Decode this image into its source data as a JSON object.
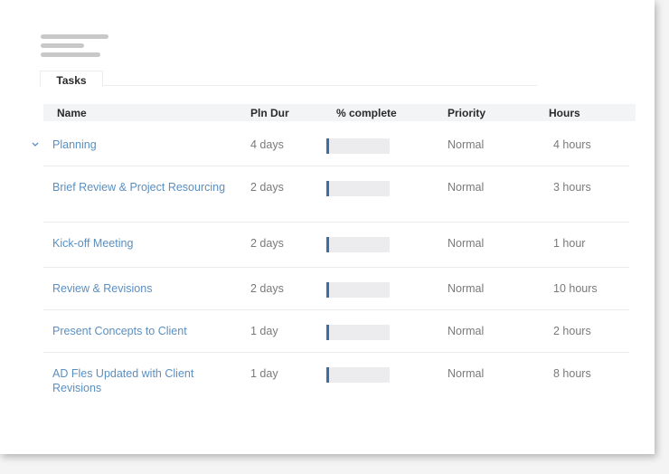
{
  "tabs": [
    {
      "label": "Tasks"
    }
  ],
  "columns": {
    "name": "Name",
    "pln_dur": "Pln Dur",
    "percent_complete": "% complete",
    "priority": "Priority",
    "hours": "Hours"
  },
  "rows": [
    {
      "name": "Planning",
      "pln_dur": "4 days",
      "percent_complete": 0.04,
      "priority": "Normal",
      "hours": "4 hours",
      "collapsible": true
    },
    {
      "name": "Brief Review & Project Resourcing",
      "pln_dur": "2 days",
      "percent_complete": 0.04,
      "priority": "Normal",
      "hours": "3 hours"
    },
    {
      "name": "Kick-off Meeting",
      "pln_dur": "2 days",
      "percent_complete": 0.04,
      "priority": "Normal",
      "hours": "1 hour"
    },
    {
      "name": "Review & Revisions",
      "pln_dur": "2 days",
      "percent_complete": 0.04,
      "priority": "Normal",
      "hours": "10 hours"
    },
    {
      "name": "Present Concepts to Client",
      "pln_dur": "1 day",
      "percent_complete": 0.04,
      "priority": "Normal",
      "hours": "2 hours"
    },
    {
      "name": "AD Fles Updated with Client Revisions",
      "pln_dur": "1 day",
      "percent_complete": 0.04,
      "priority": "Normal",
      "hours": "8 hours"
    }
  ],
  "colors": {
    "link": "#5b8fc0",
    "progress_fill": "#3a6ea5",
    "progress_track": "#ececee",
    "header_bg": "#f3f4f6"
  },
  "icons": {
    "collapse": "chevron-down-icon",
    "logo": "logo-placeholder-lines"
  }
}
